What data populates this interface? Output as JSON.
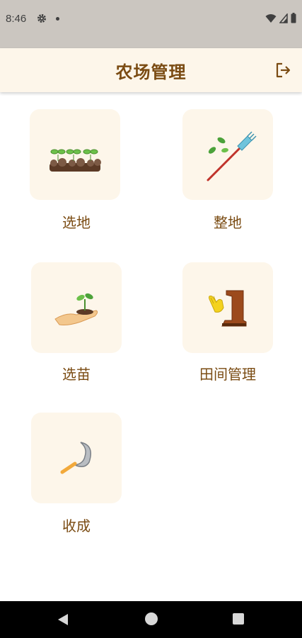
{
  "status": {
    "time": "8:46"
  },
  "header": {
    "title": "农场管理"
  },
  "menu": [
    {
      "label": "选地",
      "icon": "seedlings-in-soil-icon"
    },
    {
      "label": "整地",
      "icon": "rake-icon"
    },
    {
      "label": "选苗",
      "icon": "seedling-in-hand-icon"
    },
    {
      "label": "田间管理",
      "icon": "gloves-and-boot-icon"
    },
    {
      "label": "收成",
      "icon": "sickle-icon"
    }
  ],
  "colors": {
    "accent": "#7a4b12",
    "tile_bg": "#fdf6ea",
    "header_bg": "#fdf6ea",
    "status_bg": "#cbc6c0"
  }
}
